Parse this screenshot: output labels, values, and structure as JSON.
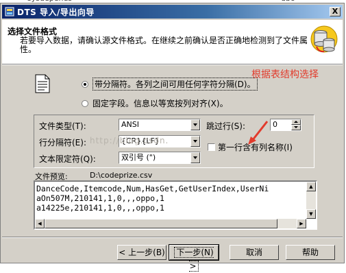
{
  "background": {
    "fragment_left": "sysdepends",
    "fragment_right": "dbo"
  },
  "window": {
    "title": "DTS 导入/导出向导",
    "close_label": "X"
  },
  "header": {
    "heading": "选择文件格式",
    "description": "若要导入数据，请确认源文件格式。在继续之前确认是否正确地检测到了文件属性。"
  },
  "options": {
    "delimited_label": "带分隔符。各列之间可用任何字符分隔(D)。",
    "delimited_selected": true,
    "fixed_label": "固定字段。信息以等宽按列对齐(X)。",
    "fixed_selected": false
  },
  "annotation": {
    "text": "根据表结构选择",
    "color": "#e23b2c"
  },
  "fields": {
    "file_type_label": "文件类型(T):",
    "file_type_value": "ANSI",
    "row_delim_label": "行分隔符(E):",
    "row_delim_value": "{CR}{LF}",
    "text_qualifier_label": "文本限定符(Q):",
    "text_qualifier_value": "双引号 (\")",
    "skip_rows_label": "跳过行(S):",
    "skip_rows_value": "0",
    "first_row_label": "第一行含有列名称(I)",
    "first_row_checked": false
  },
  "watermark": "http://blog.csdn.",
  "preview": {
    "label": "文件预览:",
    "path": "D:\\codeprize.csv",
    "lines": [
      "DanceCode,Itemcode,Num,HasGet,GetUserIndex,UserNi",
      "aOn507M,210141,1,0,,,oppo,1",
      "a14225e,210141,1,0,,,oppo,1"
    ]
  },
  "buttons": {
    "back": "< 上一步(B)",
    "next": "下一步(N) >",
    "cancel": "取消",
    "help": "帮助"
  },
  "colors": {
    "title_bar": "#0a246a",
    "dialog": "#d4d0c8",
    "annotation": "#e23b2c"
  }
}
